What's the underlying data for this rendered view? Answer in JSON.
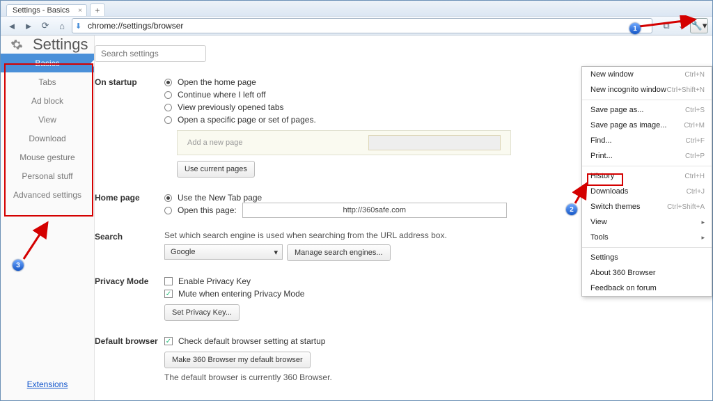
{
  "window": {
    "tab_title": "Settings - Basics"
  },
  "omnibox": {
    "url": "chrome://settings/browser"
  },
  "header": {
    "title": "Settings"
  },
  "search": {
    "placeholder": "Search settings"
  },
  "sidebar": {
    "items": [
      {
        "label": "Basics",
        "active": true
      },
      {
        "label": "Tabs"
      },
      {
        "label": "Ad block"
      },
      {
        "label": "View"
      },
      {
        "label": "Download"
      },
      {
        "label": "Mouse gesture"
      },
      {
        "label": "Personal stuff"
      },
      {
        "label": "Advanced settings"
      }
    ],
    "extensions_link": "Extensions"
  },
  "sections": {
    "startup": {
      "label": "On startup",
      "options": [
        {
          "label": "Open the home page",
          "checked": true
        },
        {
          "label": "Continue where I left off"
        },
        {
          "label": "View previously opened tabs"
        },
        {
          "label": "Open a specific page or set of pages."
        }
      ],
      "newpage_placeholder": "Add a new page",
      "use_current_btn": "Use current pages"
    },
    "homepage": {
      "label": "Home page",
      "options": [
        {
          "label": "Use the New Tab page",
          "checked": true
        },
        {
          "label": "Open this page:"
        }
      ],
      "url_value": "http://360safe.com"
    },
    "search": {
      "label": "Search",
      "desc": "Set which search engine is used when searching from the URL address box.",
      "engine": "Google",
      "manage_btn": "Manage search engines..."
    },
    "privacy": {
      "label": "Privacy Mode",
      "enable": "Enable Privacy Key",
      "mute": "Mute when entering Privacy Mode",
      "set_btn": "Set Privacy Key..."
    },
    "default": {
      "label": "Default browser",
      "check": "Check default browser setting at startup",
      "make_btn": "Make 360 Browser my default browser",
      "status": "The default browser is currently 360 Browser."
    }
  },
  "menu": {
    "new_window": {
      "label": "New window",
      "sc": "Ctrl+N"
    },
    "incognito": {
      "label": "New incognito window",
      "sc": "Ctrl+Shift+N"
    },
    "save_as": {
      "label": "Save page as...",
      "sc": "Ctrl+S"
    },
    "save_img": {
      "label": "Save page as image...",
      "sc": "Ctrl+M"
    },
    "find": {
      "label": "Find...",
      "sc": "Ctrl+F"
    },
    "print": {
      "label": "Print...",
      "sc": "Ctrl+P"
    },
    "history": {
      "label": "History",
      "sc": "Ctrl+H"
    },
    "downloads": {
      "label": "Downloads",
      "sc": "Ctrl+J"
    },
    "themes": {
      "label": "Switch themes",
      "sc": "Ctrl+Shift+A"
    },
    "view": {
      "label": "View"
    },
    "tools": {
      "label": "Tools"
    },
    "settings": {
      "label": "Settings"
    },
    "about": {
      "label": "About 360 Browser"
    },
    "feedback": {
      "label": "Feedback on forum"
    }
  },
  "annotations": {
    "b1": "1",
    "b2": "2",
    "b3": "3"
  }
}
